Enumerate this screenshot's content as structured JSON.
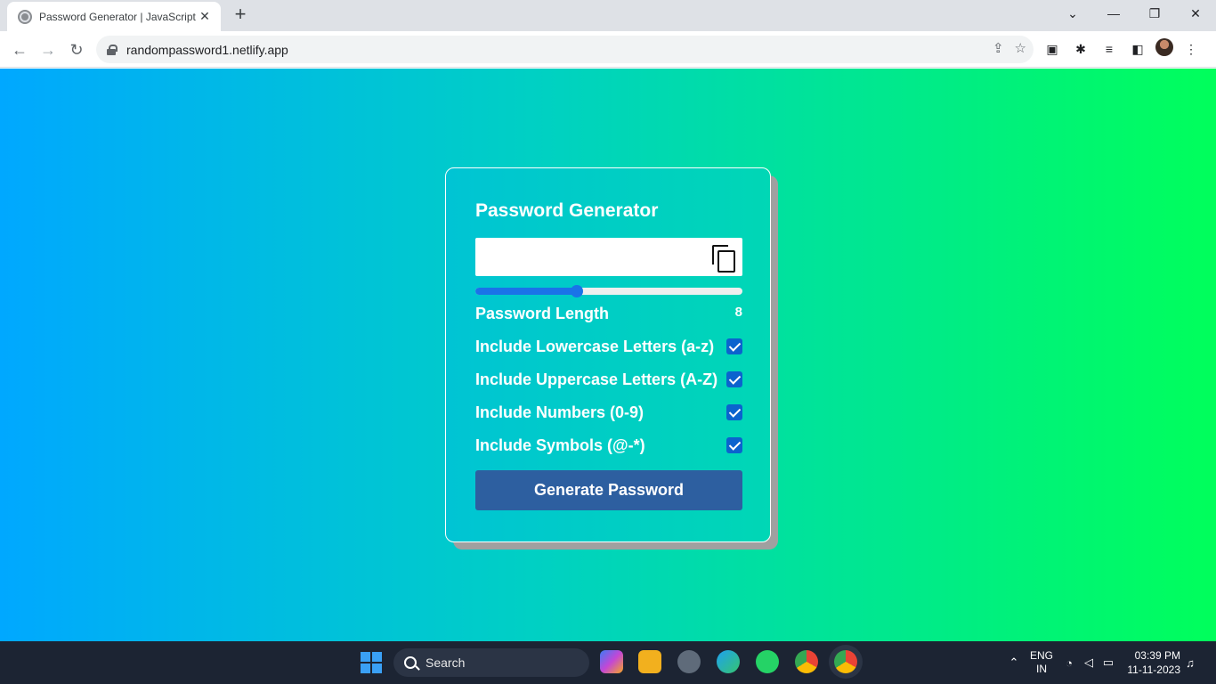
{
  "browser": {
    "tab_title": "Password Generator | JavaScript",
    "url": "randompassword1.netlify.app"
  },
  "app": {
    "title": "Password Generator",
    "password_value": "",
    "length_label": "Password Length",
    "length_value": "8",
    "slider_fraction": 0.38,
    "options": [
      {
        "label": "Include Lowercase Letters (a-z)",
        "checked": true
      },
      {
        "label": "Include Uppercase Letters (A-Z)",
        "checked": true
      },
      {
        "label": "Include Numbers (0-9)",
        "checked": true
      },
      {
        "label": "Include Symbols (@-*)",
        "checked": true
      }
    ],
    "generate_label": "Generate Password"
  },
  "taskbar": {
    "search_placeholder": "Search",
    "lang_line1": "ENG",
    "lang_line2": "IN",
    "time": "03:39 PM",
    "date": "11-11-2023"
  }
}
